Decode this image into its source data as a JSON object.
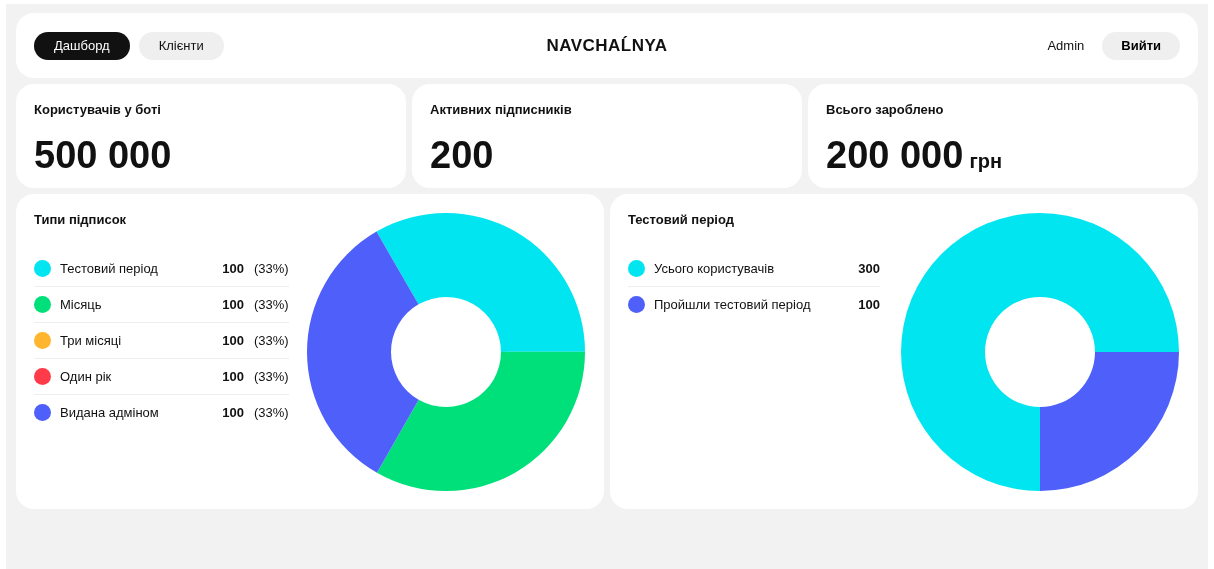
{
  "nav": {
    "tabs": [
      {
        "label": "Дашборд",
        "selected": true
      },
      {
        "label": "Клієнти",
        "selected": false
      }
    ],
    "logo": "NAVCHAĹNYA",
    "user": "Admin",
    "logout": "Вийти"
  },
  "stats": [
    {
      "label": "Користувачів у боті",
      "value": "500 000"
    },
    {
      "label": "Активних підписників",
      "value": "200"
    },
    {
      "label": "Всього зароблено",
      "value": "200 000",
      "unit": "грн"
    }
  ],
  "panels": [
    {
      "title": "Типи підписок",
      "legend": [
        {
          "count": "100",
          "share": "(33%)",
          "color": "#00e5f0"
        },
        {
          "count": "100",
          "share": "(33%)",
          "color": "#00e07a"
        },
        {
          "count": "100",
          "share": "(33%)",
          "color": "#ffb52e"
        },
        {
          "count": "100",
          "share": "(33%)",
          "color": "#ff3b4a"
        },
        {
          "count": "100",
          "share": "(33%)",
          "color": "#4f5ffa"
        }
      ],
      "chart_data": {
        "type": "donut",
        "categories": [
          "Тестовий період",
          "Місяць",
          "Три місяці",
          "Один рік",
          "Видана адміном"
        ],
        "values": [
          33.3,
          33.3,
          0,
          0,
          33.4
        ]
      }
    },
    {
      "title": "Тестовий період",
      "legend": [
        {
          "count": "300",
          "color": "#00e5f0"
        },
        {
          "count": "100",
          "color": "#4f5ffa"
        }
      ],
      "chart_data": {
        "type": "donut",
        "categories": [
          "Усього користувачів",
          "Пройшли тестовий період"
        ],
        "values": [
          75,
          25
        ]
      }
    }
  ]
}
